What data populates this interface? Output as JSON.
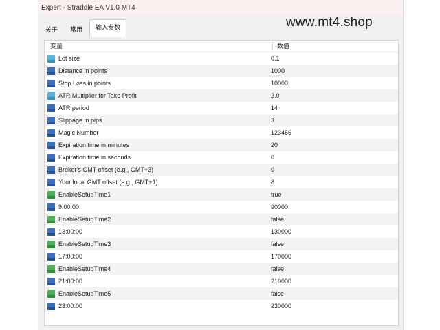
{
  "window": {
    "title": "Expert - Straddle EA V1.0 MT4"
  },
  "watermark": "www.mt4.shop",
  "tabs": [
    {
      "label": "关于",
      "active": false
    },
    {
      "label": "常用",
      "active": false
    },
    {
      "label": "输入参数",
      "active": true
    }
  ],
  "table": {
    "col_variable": "变量",
    "col_value": "数值",
    "rows": [
      {
        "name": "Lot size",
        "value": "0.1",
        "icon": "double"
      },
      {
        "name": "Distance in points",
        "value": "1000",
        "icon": "numeric"
      },
      {
        "name": "Stop Loss in points",
        "value": "10000",
        "icon": "numeric"
      },
      {
        "name": "ATR Multiplier for Take Profit",
        "value": "2.0",
        "icon": "double"
      },
      {
        "name": "ATR period",
        "value": "14",
        "icon": "numeric"
      },
      {
        "name": "Slippage in pips",
        "value": "3",
        "icon": "numeric"
      },
      {
        "name": "Magic Number",
        "value": "123456",
        "icon": "numeric"
      },
      {
        "name": "Expiration time in minutes",
        "value": "20",
        "icon": "numeric"
      },
      {
        "name": "Expiration time in seconds",
        "value": "0",
        "icon": "numeric"
      },
      {
        "name": "Broker's GMT offset (e.g., GMT+3)",
        "value": "0",
        "icon": "numeric"
      },
      {
        "name": "Your local GMT offset (e.g., GMT+1)",
        "value": "8",
        "icon": "numeric"
      },
      {
        "name": "EnableSetupTime1",
        "value": "true",
        "icon": "bool"
      },
      {
        "name": "9:00:00",
        "value": "90000",
        "icon": "numeric"
      },
      {
        "name": "EnableSetupTime2",
        "value": "false",
        "icon": "bool"
      },
      {
        "name": "13:00:00",
        "value": "130000",
        "icon": "numeric"
      },
      {
        "name": "EnableSetupTime3",
        "value": "false",
        "icon": "bool"
      },
      {
        "name": "17:00:00",
        "value": "170000",
        "icon": "numeric"
      },
      {
        "name": "EnableSetupTime4",
        "value": "false",
        "icon": "bool"
      },
      {
        "name": "21:00:00",
        "value": "210000",
        "icon": "numeric"
      },
      {
        "name": "EnableSetupTime5",
        "value": "false",
        "icon": "bool"
      },
      {
        "name": "23:00:00",
        "value": "230000",
        "icon": "numeric"
      }
    ]
  }
}
